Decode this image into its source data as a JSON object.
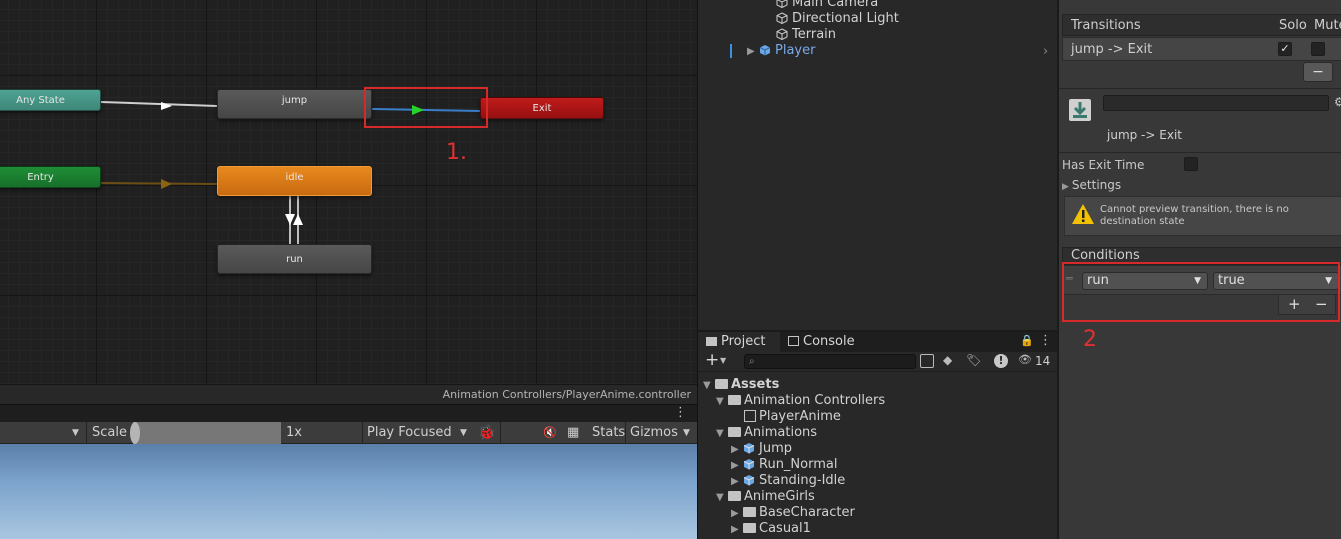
{
  "animator": {
    "states": {
      "any_state": "Any State",
      "entry": "Entry",
      "jump": "jump",
      "exit": "Exit",
      "idle": "idle",
      "run": "run"
    },
    "annotation_marker": "1.",
    "status_path": "Animation Controllers/PlayerAnime.controller"
  },
  "game_view": {
    "scale_label": "Scale",
    "scale_value": "1x",
    "play_mode": "Play Focused",
    "stats_label": "Stats",
    "gizmos_label": "Gizmos"
  },
  "hierarchy": {
    "items": [
      "Main Camera",
      "Directional Light",
      "Terrain",
      "Player"
    ],
    "selected_color": "#7aa9e8"
  },
  "project": {
    "tabs": [
      "Project",
      "Console"
    ],
    "hidden_count": "14",
    "tree": {
      "assets": "Assets",
      "animation_controllers": "Animation Controllers",
      "player_anime": "PlayerAnime",
      "animations": "Animations",
      "jump": "Jump",
      "run_normal": "Run_Normal",
      "standing_idle": "Standing-Idle",
      "anime_girls": "AnimeGirls",
      "base_character": "BaseCharacter",
      "casual1": "Casual1"
    }
  },
  "inspector": {
    "transitions_header": "Transitions",
    "solo_label": "Solo",
    "mute_label": "Mute",
    "transition_name": "jump -> Exit",
    "transition_title": "jump -> Exit",
    "has_exit_time_label": "Has Exit Time",
    "settings_label": "Settings",
    "warning_text": "Cannot preview transition, there is no destination state",
    "conditions_header": "Conditions",
    "condition_parameter": "run",
    "condition_value": "true",
    "annotation_marker": "2",
    "minus_symbol": "−",
    "plus_symbol": "+"
  }
}
